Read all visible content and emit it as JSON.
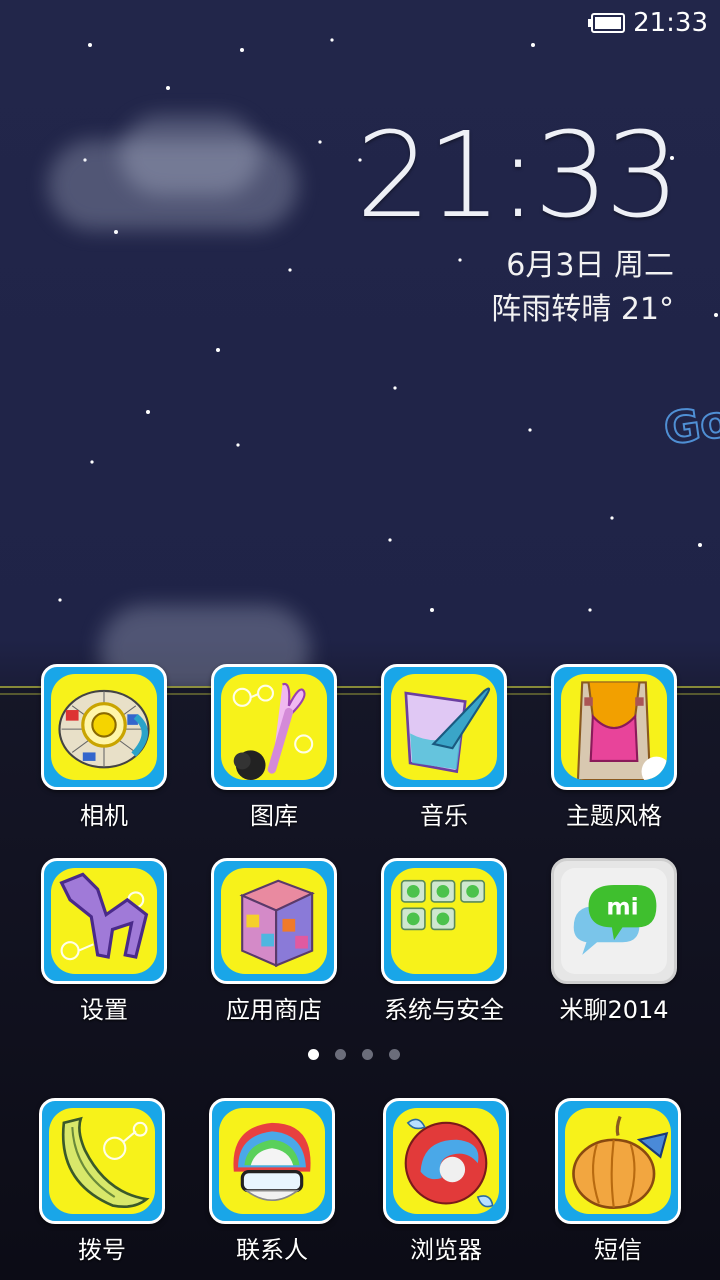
{
  "status_bar": {
    "time": "21:33",
    "battery_level": 1.0
  },
  "lockscreen_widget": {
    "clock": "21:33",
    "date": "6月3日 周二",
    "weather": "阵雨转晴   21°"
  },
  "wallpaper": {
    "text": "Go"
  },
  "home_grid": {
    "apps": [
      {
        "label": "相机",
        "icon": "camera-icon"
      },
      {
        "label": "图库",
        "icon": "gallery-icon"
      },
      {
        "label": "音乐",
        "icon": "music-icon"
      },
      {
        "label": "主题风格",
        "icon": "theme-icon"
      },
      {
        "label": "设置",
        "icon": "settings-icon"
      },
      {
        "label": "应用商店",
        "icon": "app-store-icon"
      },
      {
        "label": "系统与安全",
        "icon": "system-security-icon"
      },
      {
        "label": "米聊2014",
        "icon": "miliao-icon"
      }
    ]
  },
  "page_indicator": {
    "total": 4,
    "active": 0
  },
  "dock": {
    "apps": [
      {
        "label": "拨号",
        "icon": "phone-icon"
      },
      {
        "label": "联系人",
        "icon": "contacts-icon"
      },
      {
        "label": "浏览器",
        "icon": "browser-icon"
      },
      {
        "label": "短信",
        "icon": "sms-icon"
      }
    ]
  },
  "colors": {
    "icon_border": "#19a6e8",
    "icon_bg": "#f7f21a",
    "sky": "#22264a"
  }
}
